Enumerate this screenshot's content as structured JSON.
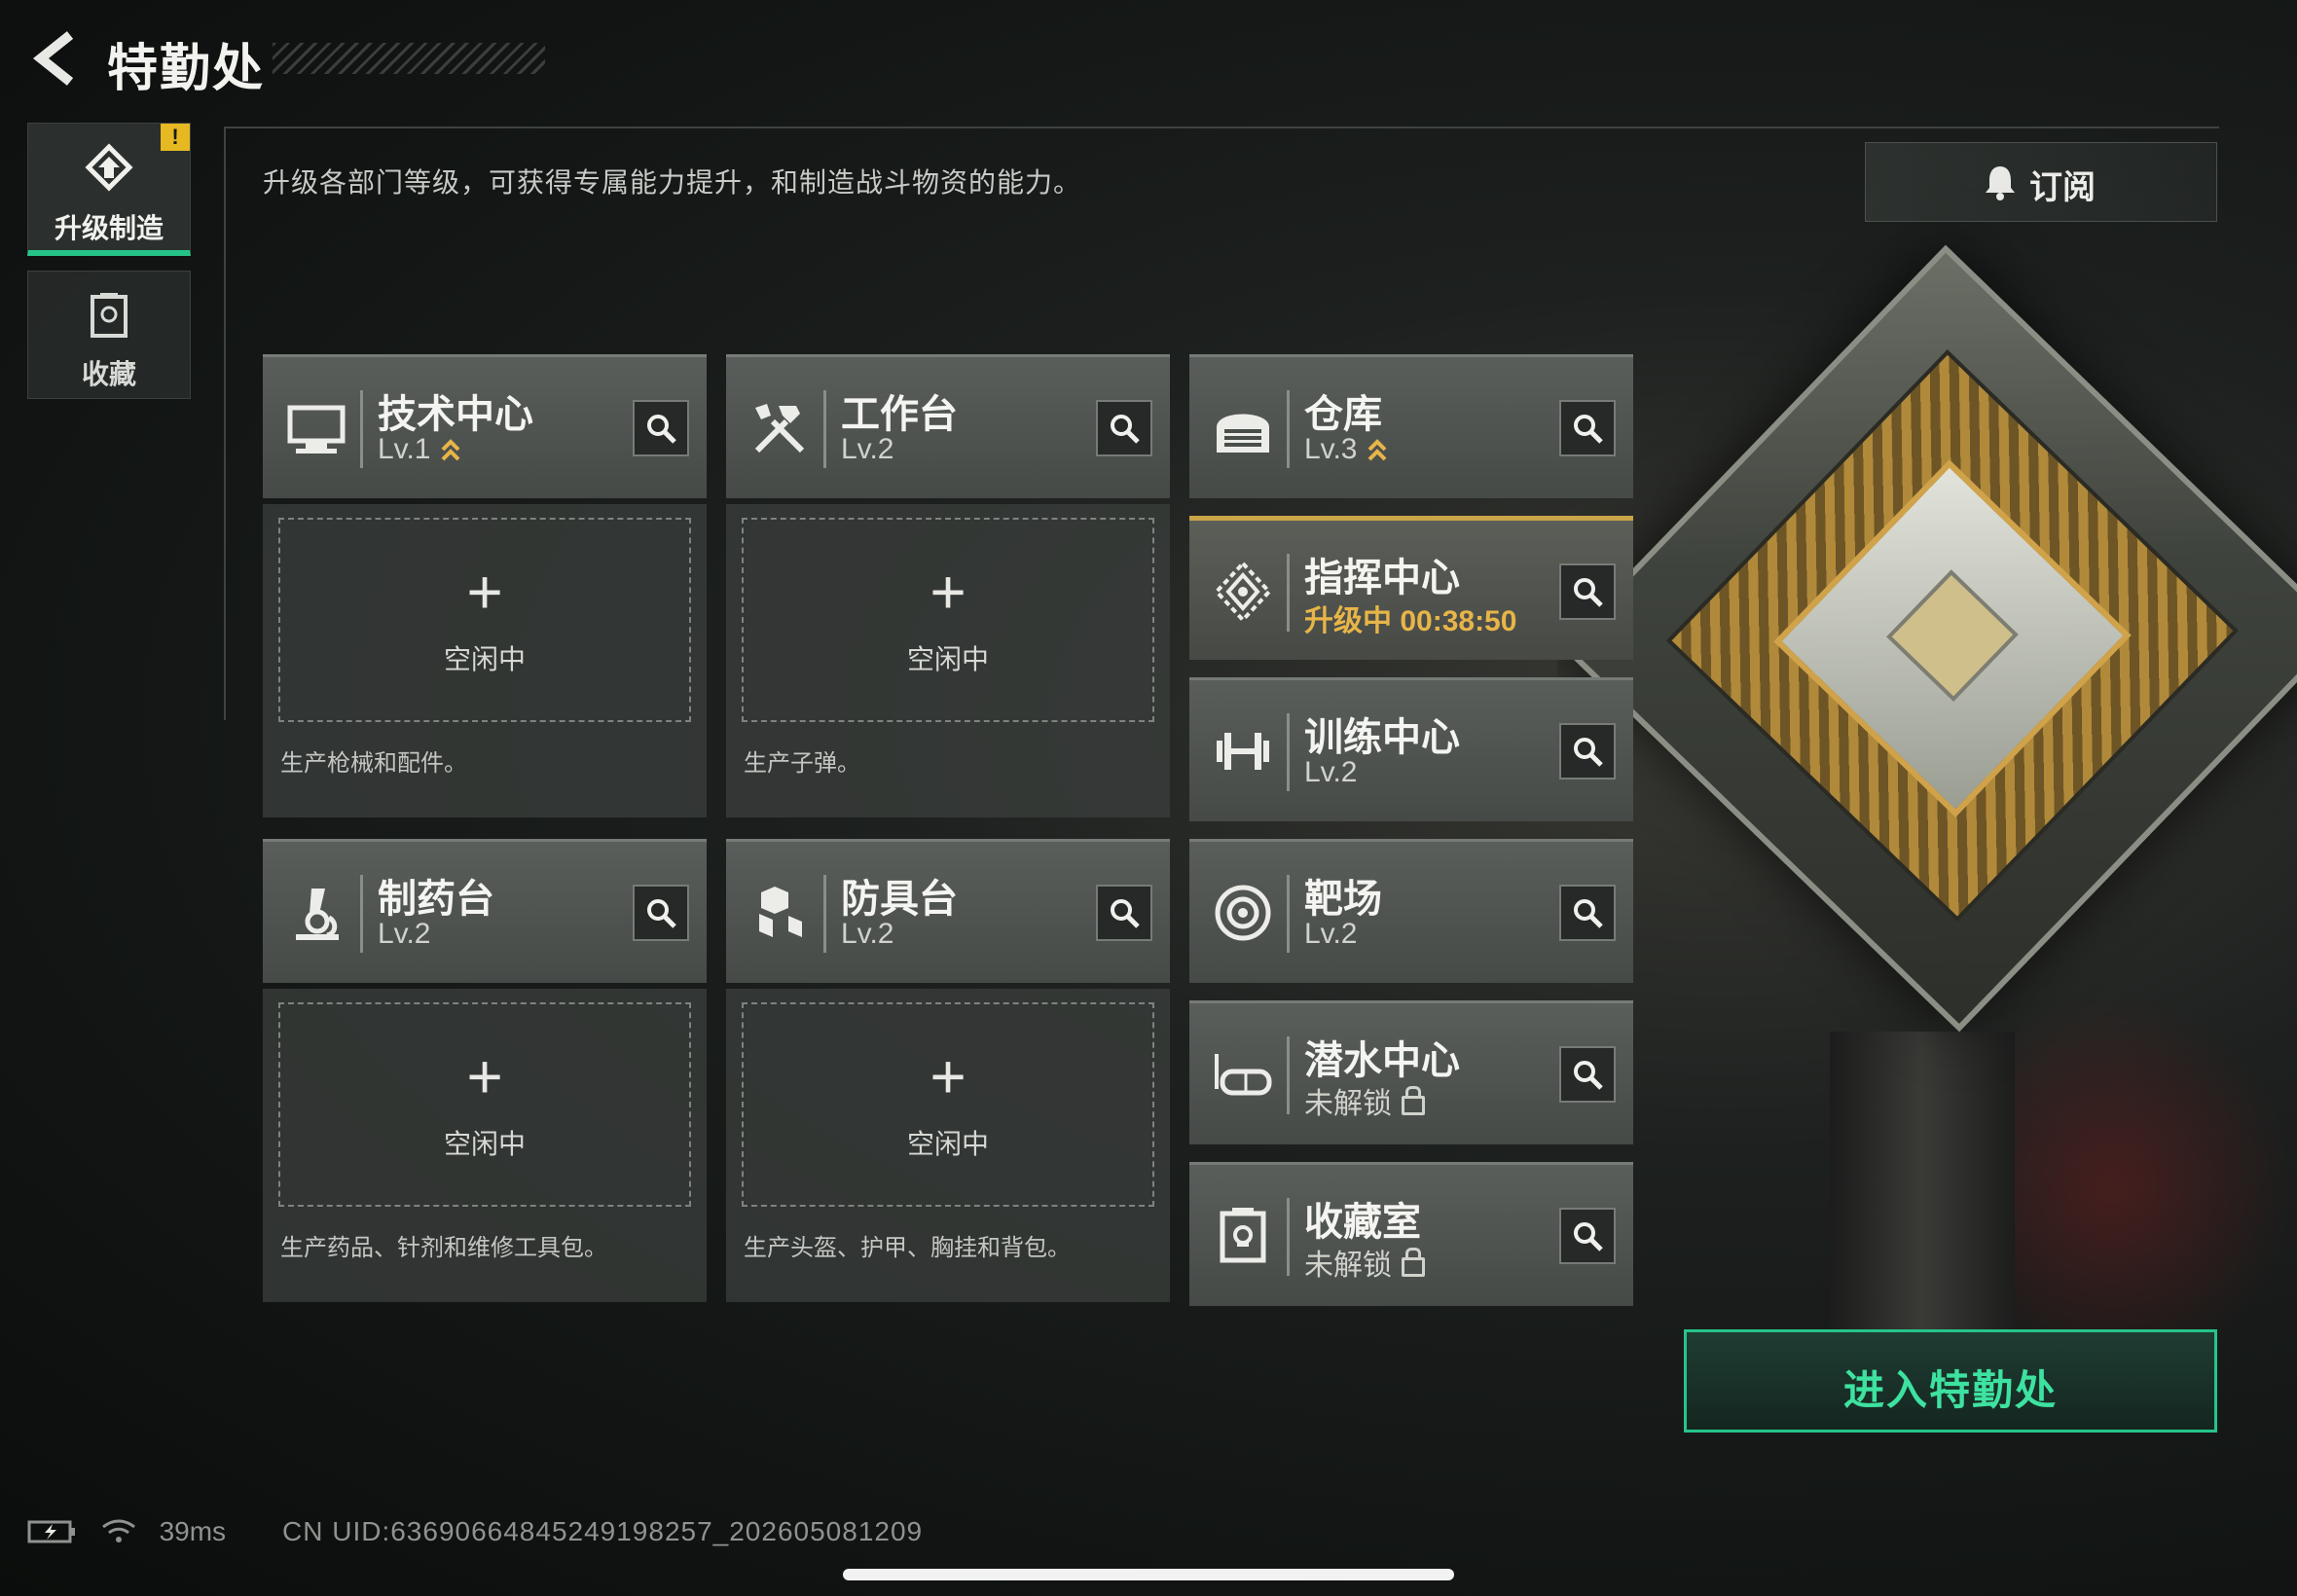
{
  "header": {
    "title": "特勤处"
  },
  "sidebar": {
    "tabs": [
      {
        "label": "升级制造",
        "icon": "upgrade-icon",
        "badge": "!"
      },
      {
        "label": "收藏",
        "icon": "collection-icon"
      }
    ]
  },
  "main": {
    "description": "升级各部门等级，可获得专属能力提升，和制造战斗物资的能力。",
    "subscribe_label": "订阅"
  },
  "production": [
    {
      "name": "技术中心",
      "level": "Lv.1",
      "upgradable": true,
      "icon": "monitor-icon",
      "slot_status": "空闲中",
      "note": "生产枪械和配件。"
    },
    {
      "name": "工作台",
      "level": "Lv.2",
      "upgradable": false,
      "icon": "tools-icon",
      "slot_status": "空闲中",
      "note": "生产子弹。"
    },
    {
      "name": "制药台",
      "level": "Lv.2",
      "upgradable": false,
      "icon": "microscope-icon",
      "slot_status": "空闲中",
      "note": "生产药品、针剂和维修工具包。"
    },
    {
      "name": "防具台",
      "level": "Lv.2",
      "upgradable": false,
      "icon": "armor-icon",
      "slot_status": "空闲中",
      "note": "生产头盔、护甲、胸挂和背包。"
    }
  ],
  "facilities": [
    {
      "name": "仓库",
      "status": "Lv.3",
      "upgradable": true,
      "icon": "warehouse-icon"
    },
    {
      "name": "指挥中心",
      "status": "升级中 00:38:50",
      "upgrading": true,
      "icon": "command-icon"
    },
    {
      "name": "训练中心",
      "status": "Lv.2",
      "icon": "dumbbell-icon"
    },
    {
      "name": "靶场",
      "status": "Lv.2",
      "icon": "target-icon"
    },
    {
      "name": "潜水中心",
      "status": "未解锁",
      "locked": true,
      "icon": "diving-mask-icon"
    },
    {
      "name": "收藏室",
      "status": "未解锁",
      "locked": true,
      "icon": "trophy-icon"
    }
  ],
  "enter_button": "进入特勤处",
  "status": {
    "ping": "39ms",
    "uid": "CN UID:636906648452491982​57_202605081209"
  },
  "colors": {
    "accent": "#27c48a",
    "gold": "#e7b548",
    "badge": "#e6b822"
  }
}
